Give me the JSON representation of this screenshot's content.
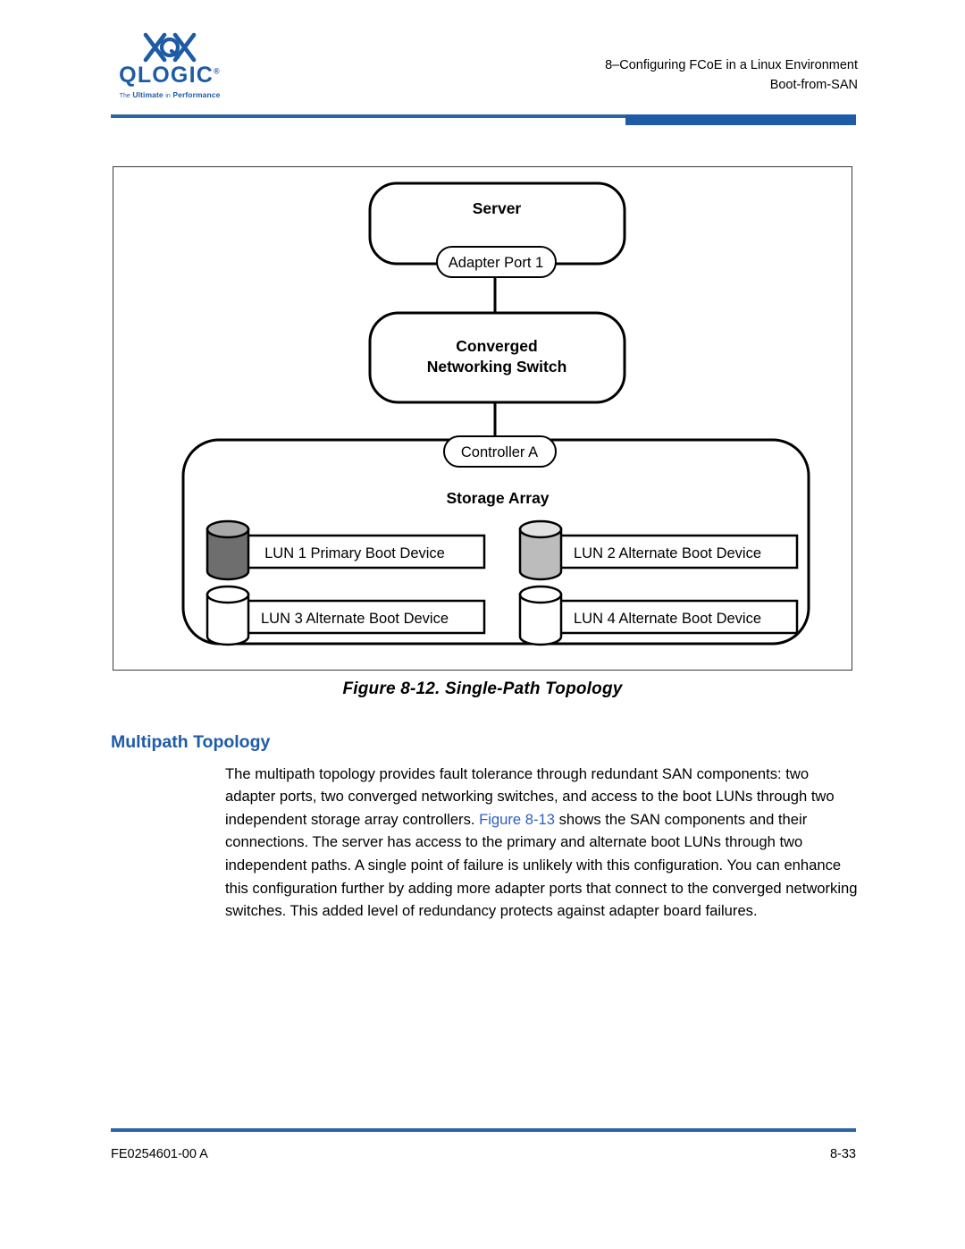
{
  "header": {
    "logo": {
      "wordmark": "QLOGIC",
      "registered_mark": "®",
      "tagline_part1": "The",
      "tagline_part2": "Ultimate",
      "tagline_part3": "in",
      "tagline_part4": "Performance"
    },
    "chapter_line": "8–Configuring FCoE in a Linux Environment",
    "section_line": "Boot-from-SAN",
    "rule_color": "#1f5ca8"
  },
  "figure": {
    "caption": "Figure 8-12. Single-Path Topology",
    "server": {
      "title": "Server",
      "port": "Adapter Port 1"
    },
    "switch": {
      "line1": "Converged",
      "line2": "Networking Switch"
    },
    "storage": {
      "controller": "Controller A",
      "title": "Storage Array",
      "luns": [
        {
          "label": "LUN 1 Primary Boot Device",
          "body_color": "#6e6e6e",
          "top_color": "#a8a8a8"
        },
        {
          "label": "LUN 2 Alternate Boot Device",
          "body_color": "#bcbcbc",
          "top_color": "#e2e2e2"
        },
        {
          "label": "LUN 3 Alternate Boot Device",
          "body_color": "#ffffff",
          "top_color": "#ffffff"
        },
        {
          "label": "LUN 4 Alternate Boot Device",
          "body_color": "#ffffff",
          "top_color": "#ffffff"
        }
      ]
    }
  },
  "content": {
    "heading": "Multipath Topology",
    "paragraph_part1": "The multipath topology provides fault tolerance through redundant SAN components: two adapter ports, two converged networking switches, and access to the boot LUNs through two independent storage array controllers. ",
    "paragraph_xref": "Figure 8-13",
    "paragraph_part2": " shows the SAN components and their connections. The server has access to the primary and alternate boot LUNs through two independent paths. A single point of failure is unlikely with this configuration. You can enhance this configuration further by adding more adapter ports that connect to the converged networking switches. This added level of redundancy protects against adapter board failures."
  },
  "footer": {
    "document_number": "FE0254601-00 A",
    "page_number": "8-33"
  }
}
